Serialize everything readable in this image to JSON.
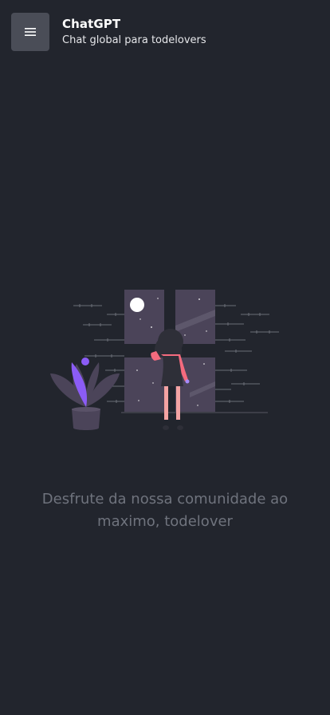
{
  "header": {
    "menu_icon": "hamburger-menu-icon",
    "title": "ChatGPT",
    "subtitle": "Chat global para todelovers"
  },
  "empty_state": {
    "illustration": "woman-looking-out-night-window-illustration",
    "message": "Desfrute da nossa comunidade ao maximo, todelover"
  },
  "colors": {
    "background": "#22252d",
    "menu_button": "#4a4d57",
    "accent_purple": "#8b5cf6",
    "accent_pink": "#f56b7e",
    "message_text": "#6f737d"
  }
}
